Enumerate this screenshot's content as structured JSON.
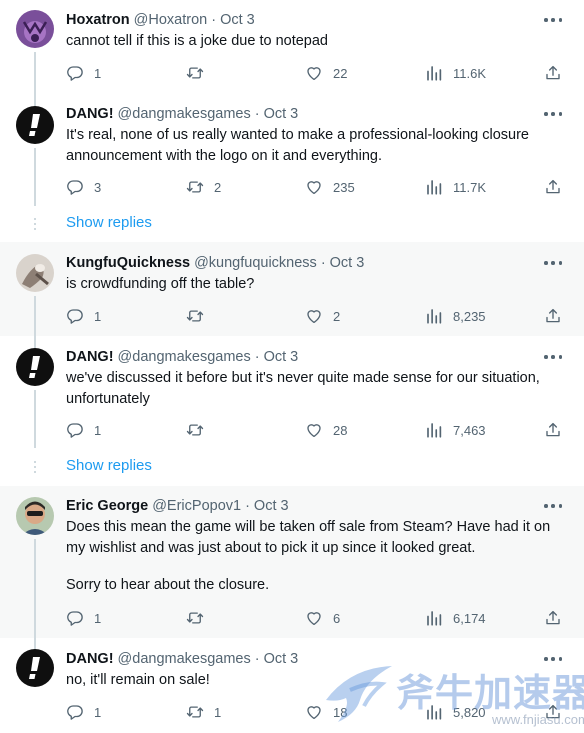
{
  "tweets": [
    {
      "name": "Hoxatron",
      "handle": "@Hoxatron",
      "date": "Oct 3",
      "text": [
        "cannot tell if this is a joke due to notepad"
      ],
      "replies": "1",
      "retweets": "",
      "likes": "22",
      "views": "11.6K"
    },
    {
      "name": "DANG!",
      "handle": "@dangmakesgames",
      "date": "Oct 3",
      "text": [
        "It's real, none of us really wanted to make a professional-looking closure announcement with the logo on it and everything."
      ],
      "replies": "3",
      "retweets": "2",
      "likes": "235",
      "views": "11.7K"
    },
    {
      "name": "KungfuQuickness",
      "handle": "@kungfuquickness",
      "date": "Oct 3",
      "text": [
        "is crowdfunding off the table?"
      ],
      "replies": "1",
      "retweets": "",
      "likes": "2",
      "views": "8,235"
    },
    {
      "name": "DANG!",
      "handle": "@dangmakesgames",
      "date": "Oct 3",
      "text": [
        "we've discussed it before but it's never quite made sense for our situation, unfortunately"
      ],
      "replies": "1",
      "retweets": "",
      "likes": "28",
      "views": "7,463"
    },
    {
      "name": "Eric George",
      "handle": "@EricPopov1",
      "date": "Oct 3",
      "text": [
        "Does this mean the game will be taken off sale from Steam? Have had it on my wishlist and was just about to pick it up since it looked great.",
        "Sorry to hear about the closure."
      ],
      "replies": "1",
      "retweets": "",
      "likes": "6",
      "views": "6,174"
    },
    {
      "name": "DANG!",
      "handle": "@dangmakesgames",
      "date": "Oct 3",
      "text": [
        "no, it'll remain on sale!"
      ],
      "replies": "1",
      "retweets": "1",
      "likes": "18",
      "views": "5,820"
    }
  ],
  "show_replies_label": "Show replies",
  "separator": "·",
  "watermark": {
    "text": "斧牛加速器",
    "url": "www.fnjiasu.com"
  },
  "colors": {
    "accent": "#1d9bf0",
    "muted": "#536471",
    "text": "#0f1419",
    "shaded_bg": "#f7f8f8",
    "thread_line": "#cfd9de"
  },
  "icons": [
    "reply-icon",
    "retweet-icon",
    "like-icon",
    "views-icon",
    "share-icon",
    "more-icon"
  ]
}
